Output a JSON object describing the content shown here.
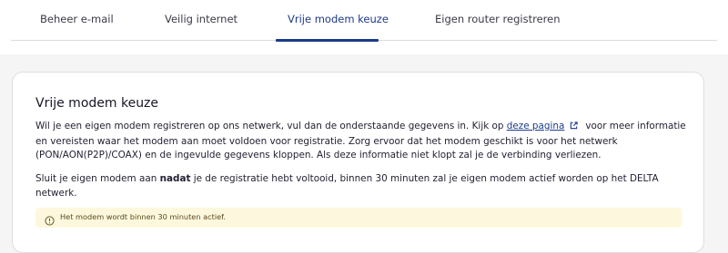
{
  "tabs": [
    {
      "label": "Beheer e-mail",
      "active": false
    },
    {
      "label": "Veilig internet",
      "active": false
    },
    {
      "label": "Vrije modem keuze",
      "active": true
    },
    {
      "label": "Eigen router registreren",
      "active": false
    }
  ],
  "card": {
    "title": "Vrije modem keuze",
    "paragraph1": {
      "before_link": "Wil je een eigen modem registreren op ons netwerk, vul dan de onderstaande gegevens in. Kijk op ",
      "link_text": "deze pagina",
      "link_icon": "external-link-icon",
      "after_link": "voor meer informatie en vereisten waar het modem aan moet voldoen voor registratie. Zorg ervoor dat het modem geschikt is voor het netwerk (PON/AON(P2P)/COAX) en de ingevulde gegevens kloppen. Als deze informatie niet klopt zal je de verbinding verliezen."
    },
    "paragraph2": {
      "before_bold": "Sluit je eigen modem aan ",
      "bold": "nadat",
      "after_bold": " je de registratie hebt voltooid, binnen 30 minuten zal je eigen modem actief worden op het DELTA netwerk."
    },
    "notice": {
      "icon": "info-circle-icon",
      "text": "Het modem wordt binnen 30 minuten actief."
    }
  },
  "colors": {
    "accent": "#1b3a88",
    "notice_bg": "#fdf8dd",
    "page_bg": "#f5f5f6"
  }
}
